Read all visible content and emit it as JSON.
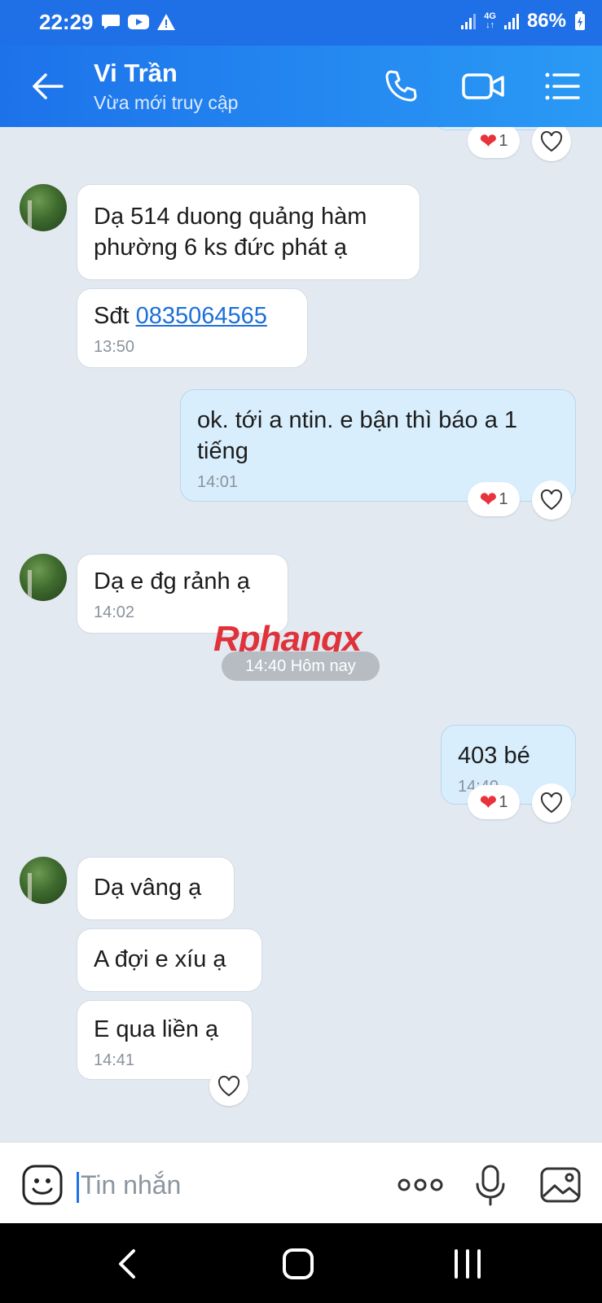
{
  "status_bar": {
    "time": "22:29",
    "network": "4G",
    "battery": "86%"
  },
  "header": {
    "contact_name": "Vi Trần",
    "contact_status": "Vừa mới truy cập"
  },
  "messages": [
    {
      "id": "m1",
      "side": "in",
      "lines": [
        "Dạ 514 duong quảng hàm",
        "phường 6 ks đức phát ạ"
      ]
    },
    {
      "id": "m2",
      "side": "in",
      "prefix": "Sđt ",
      "link": "0835064565",
      "time": "13:50"
    },
    {
      "id": "m3",
      "side": "out",
      "lines": [
        "ok. tới a ntin. e bận thì báo a 1",
        "tiếng"
      ],
      "time": "14:01",
      "reaction_count": "1"
    },
    {
      "id": "m4",
      "side": "in",
      "lines": [
        "Dạ e đg rảnh ạ"
      ],
      "time": "14:02"
    },
    {
      "id": "m5",
      "side": "out",
      "lines": [
        "403 bé"
      ],
      "time": "14:40",
      "reaction_count": "1"
    },
    {
      "id": "m6",
      "side": "in",
      "lines": [
        "Dạ vâng ạ"
      ]
    },
    {
      "id": "m7",
      "side": "in",
      "lines": [
        "A đợi e xíu ạ"
      ]
    },
    {
      "id": "m8",
      "side": "in",
      "lines": [
        "E qua liền ạ"
      ],
      "time": "14:41"
    }
  ],
  "top_reaction_count": "1",
  "date_separator": "14:40 Hôm nay",
  "watermark": {
    "part1": "Rphang",
    "part2": "x"
  },
  "composer": {
    "placeholder": "Tin nhắn"
  },
  "colors": {
    "header": "#1d72ea",
    "chat_bg": "#e2e9f1",
    "outgoing_bubble": "#d8eefd",
    "heart": "#e8323c",
    "link": "#1d6fd8"
  }
}
